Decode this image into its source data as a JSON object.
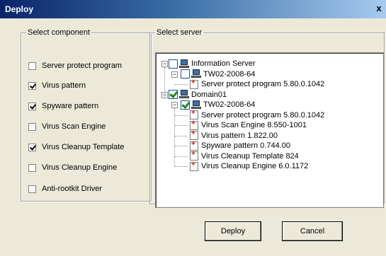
{
  "window": {
    "title": "Deploy",
    "close_glyph": "x"
  },
  "component_group": {
    "legend": "Select component",
    "items": [
      {
        "label": "Server protect program",
        "checked": false
      },
      {
        "label": "Virus pattern",
        "checked": true
      },
      {
        "label": "Spyware pattern",
        "checked": true
      },
      {
        "label": "Virus Scan Engine",
        "checked": false
      },
      {
        "label": "Virus Cleanup Template",
        "checked": true
      },
      {
        "label": "Virus Cleanup Engine",
        "checked": false
      },
      {
        "label": "Anti-rootkit Driver",
        "checked": false
      }
    ]
  },
  "server_group": {
    "legend": "Select server",
    "tree": [
      {
        "label": "Information Server",
        "level": 0,
        "kind": "group",
        "expander": "−",
        "checked": false
      },
      {
        "label": "TW02-2008-64",
        "level": 1,
        "kind": "server",
        "expander": "−",
        "checked": false
      },
      {
        "label": "Server protect program 5.80.0.1042",
        "level": 2,
        "kind": "component"
      },
      {
        "label": "Domain01",
        "level": 0,
        "kind": "group",
        "expander": "−",
        "checked": true
      },
      {
        "label": "TW02-2008-64",
        "level": 1,
        "kind": "server",
        "expander": "−",
        "checked": true
      },
      {
        "label": "Server protect program 5.80.0.1042",
        "level": 2,
        "kind": "component"
      },
      {
        "label": "Virus Scan Engine 8.550-1001",
        "level": 2,
        "kind": "component"
      },
      {
        "label": "Virus pattern 1.822.00",
        "level": 2,
        "kind": "component"
      },
      {
        "label": "Spyware pattern 0.744.00",
        "level": 2,
        "kind": "component"
      },
      {
        "label": "Virus Cleanup Template 824",
        "level": 2,
        "kind": "component"
      },
      {
        "label": "Virus Cleanup Engine 6.0.1172",
        "level": 2,
        "kind": "component"
      }
    ]
  },
  "buttons": {
    "deploy": "Deploy",
    "cancel": "Cancel"
  }
}
